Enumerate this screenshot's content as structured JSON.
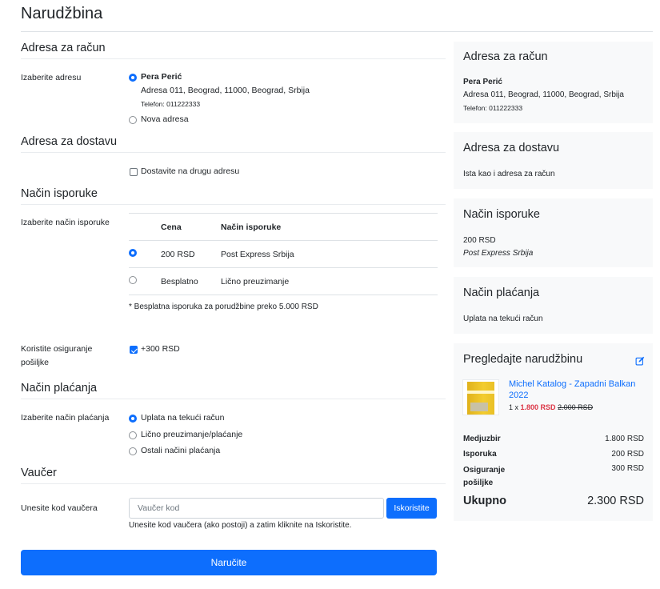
{
  "page": {
    "title": "Narudžbina"
  },
  "billing": {
    "section_title": "Adresa za račun",
    "label": "Izaberite adresu",
    "selected": {
      "name": "Pera Perić",
      "address": "Adresa 011, Beograd, 11000, Beograd, Srbija",
      "phone": "Telefon: 011222333"
    },
    "new_address": "Nova adresa"
  },
  "delivery": {
    "section_title": "Adresa za dostavu",
    "checkbox_label": "Dostavite na drugu adresu"
  },
  "shipping": {
    "section_title": "Način isporuke",
    "label": "Izaberite način isporuke",
    "columns": [
      "Cena",
      "Način isporuke"
    ],
    "rows": [
      {
        "price": "200 RSD",
        "method": "Post Express Srbija",
        "selected": true
      },
      {
        "price": "Besplatno",
        "method": "Lično preuzimanje",
        "selected": false
      }
    ],
    "note": "* Besplatna isporuka za porudžbine preko 5.000 RSD",
    "insurance_label": "Koristite osiguranje pošiljke",
    "insurance_option": "+300 RSD"
  },
  "payment": {
    "section_title": "Način plaćanja",
    "label": "Izaberite način plaćanja",
    "options": [
      "Uplata na tekući račun",
      "Lično preuzimanje/plaćanje",
      "Ostali načini plaćanja"
    ]
  },
  "voucher": {
    "section_title": "Vaučer",
    "label": "Unesite kod vaučera",
    "placeholder": "Vaučer kod",
    "apply_label": "Iskoristite",
    "help": "Unesite kod vaučera (ako postoji) a zatim kliknite na Iskoristite."
  },
  "order_button": "Naručite",
  "summary": {
    "billing": {
      "title": "Adresa za račun",
      "name": "Pera Perić",
      "address": "Adresa 011, Beograd, 11000, Beograd, Srbija",
      "phone": "Telefon: 011222333"
    },
    "delivery": {
      "title": "Adresa za dostavu",
      "text": "Ista kao i adresa za račun"
    },
    "shipping": {
      "title": "Način isporuke",
      "price": "200 RSD",
      "method": "Post Express Srbija"
    },
    "payment": {
      "title": "Način plaćanja",
      "text": "Uplata na tekući račun"
    },
    "review": {
      "title": "Pregledajte narudžbinu",
      "item": {
        "name": "Michel Katalog - Zapadni Balkan 2022",
        "qty": "1 x",
        "price": "1.800 RSD",
        "old_price": "2.000 RSD"
      },
      "lines": [
        {
          "label": "Medjuzbir",
          "value": "1.800 RSD"
        },
        {
          "label": "Isporuka",
          "value": "200 RSD"
        },
        {
          "label": "Osiguranje pošiljke",
          "value": "300 RSD"
        }
      ],
      "total_label": "Ukupno",
      "total_value": "2.300 RSD"
    }
  },
  "colors": {
    "primary": "#0d6efd",
    "danger": "#dc3545",
    "card_bg": "#f8f9fa"
  }
}
